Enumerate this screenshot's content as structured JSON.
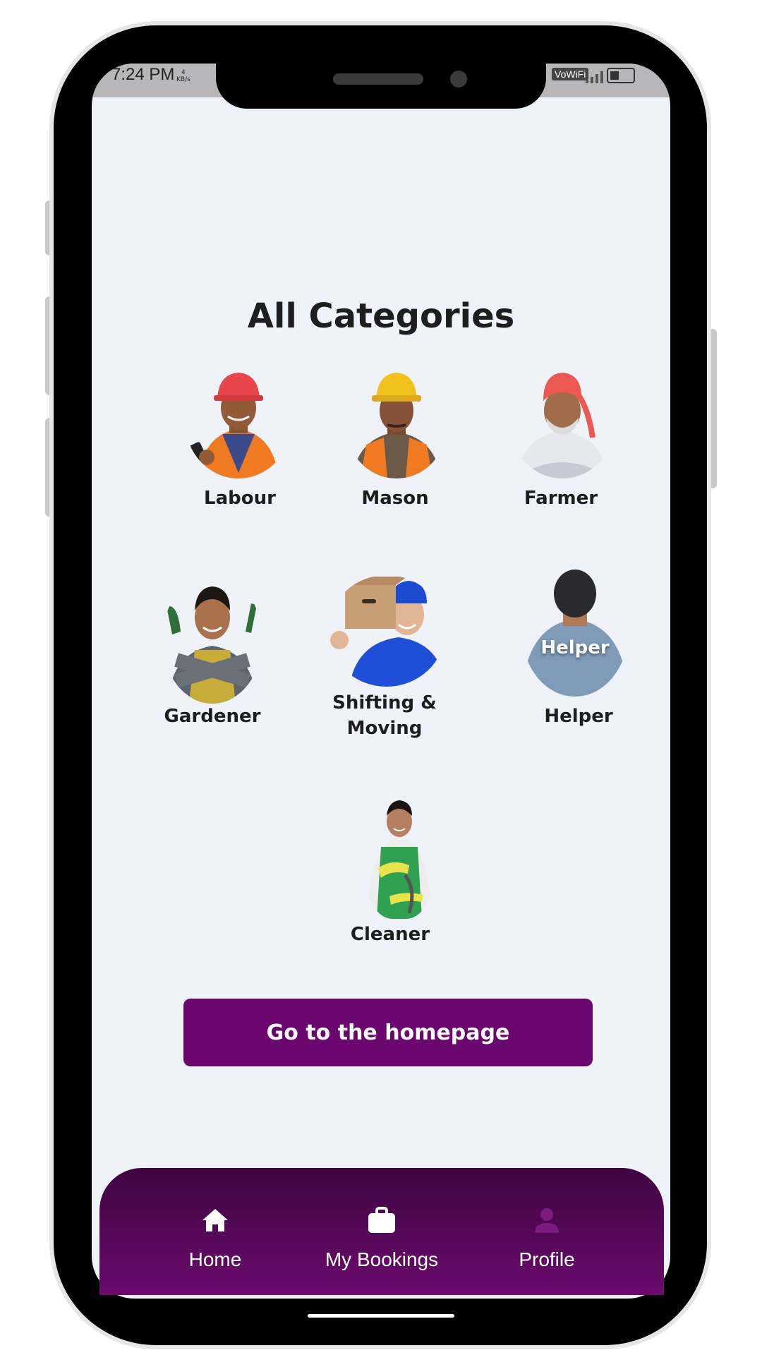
{
  "status_bar": {
    "time": "7:24 PM",
    "speed_value": "4",
    "speed_unit": "KB/s",
    "network": "VoWiFi"
  },
  "title": "All Categories",
  "categories": [
    {
      "label": "Labour"
    },
    {
      "label": "Mason"
    },
    {
      "label": "Farmer"
    },
    {
      "label": "Gardener"
    },
    {
      "label": "Shifting &",
      "label_line2": "Moving"
    },
    {
      "label": "Helper",
      "overlay": "Helper"
    },
    {
      "label": "Cleaner"
    }
  ],
  "homepage_button": "Go to the homepage",
  "bottom_nav": [
    {
      "label": "Home",
      "icon": "home-icon",
      "active": true
    },
    {
      "label": "My Bookings",
      "icon": "briefcase-icon",
      "active": true
    },
    {
      "label": "Profile",
      "icon": "person-icon",
      "active": false
    }
  ],
  "colors": {
    "accent": "#6c066f",
    "background": "#eff2f8",
    "nav_inactive_icon": "#7d1a80"
  }
}
